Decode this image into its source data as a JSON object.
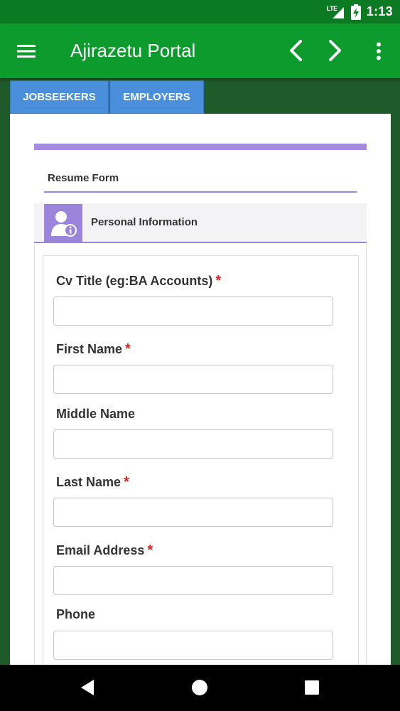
{
  "status_bar": {
    "network": "LTE",
    "time": "1:13"
  },
  "app_bar": {
    "title": "Ajirazetu Portal",
    "icons": [
      "menu-icon",
      "chevron-left-icon",
      "chevron-right-icon",
      "more-vert-icon"
    ]
  },
  "tabs": [
    {
      "label": "JOBSEEKERS"
    },
    {
      "label": "EMPLOYERS"
    }
  ],
  "form": {
    "heading": "Resume Form",
    "section_title": "Personal Information",
    "section_icon": "user-info-icon",
    "required_marker": "*",
    "fields": [
      {
        "label": "Cv Title (eg:BA Accounts)",
        "required": true,
        "value": ""
      },
      {
        "label": "First Name",
        "required": true,
        "value": ""
      },
      {
        "label": "Middle Name",
        "required": false,
        "value": ""
      },
      {
        "label": "Last Name",
        "required": true,
        "value": ""
      },
      {
        "label": "Email Address",
        "required": true,
        "value": ""
      },
      {
        "label": "Phone",
        "required": false,
        "value": ""
      }
    ]
  },
  "colors": {
    "status_bar": "#0b7a23",
    "app_bar": "#0c9b2c",
    "tab": "#4a8fdc",
    "accent_purple": "#a88be0",
    "required": "#e02020"
  },
  "nav_bar": {
    "icons": [
      "back-triangle-icon",
      "home-circle-icon",
      "recents-square-icon"
    ]
  }
}
